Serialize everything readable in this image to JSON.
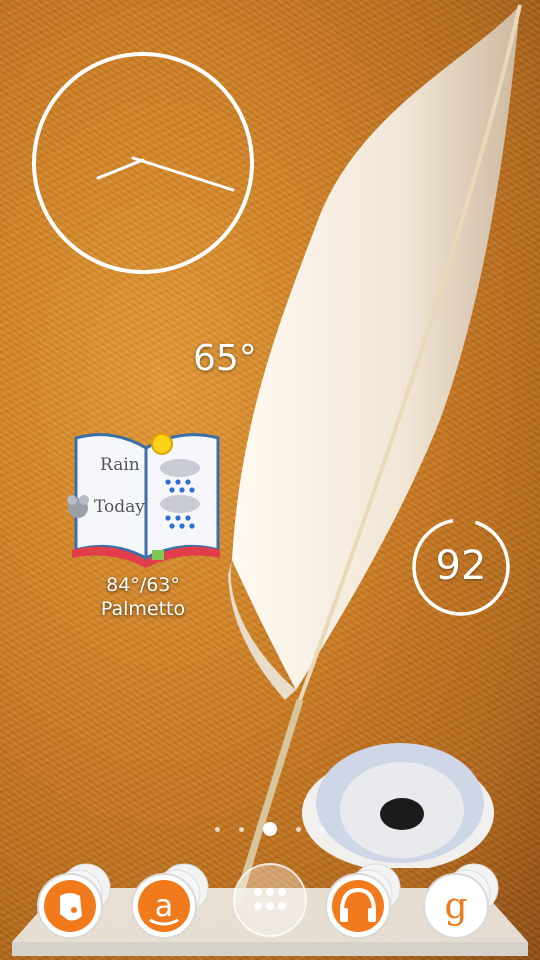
{
  "clock": {
    "hour_hand_angle_deg": 250,
    "minute_hand_angle_deg": 110
  },
  "weather": {
    "current_temp": "65°",
    "widget_text_line1": "Rain",
    "widget_text_line2": "Today",
    "high_low": "84°/63°",
    "location": "Palmetto"
  },
  "battery": {
    "level": "92",
    "fraction": 0.92
  },
  "home_pages": {
    "count": 5,
    "active_index": 2
  },
  "dock": {
    "apps": [
      "Evernote",
      "Amazon",
      "App Drawer",
      "Music",
      "Google"
    ],
    "accent": "#f07a1c"
  },
  "colors": {
    "background": "#d88a2a",
    "feather": "#f4ece0",
    "accent": "#f07a1c"
  }
}
